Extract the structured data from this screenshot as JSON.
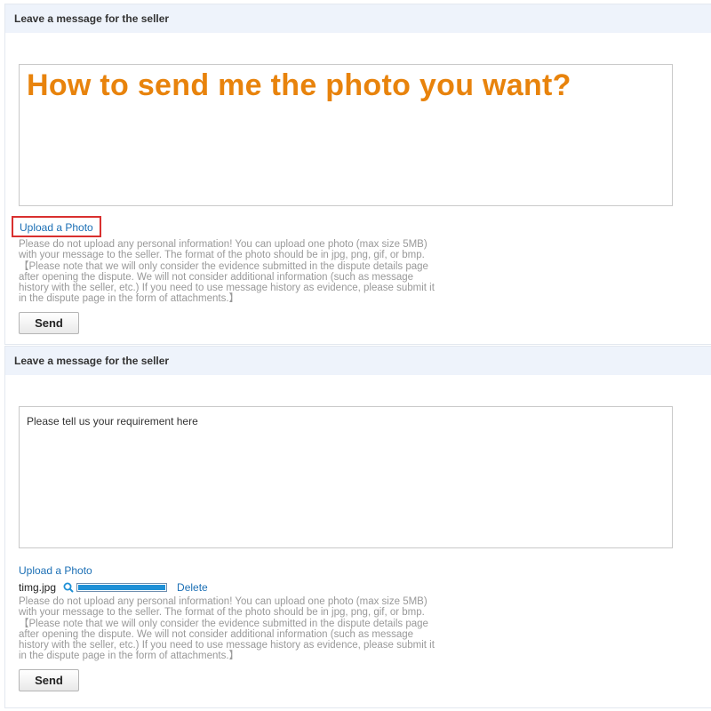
{
  "sections": [
    {
      "header": "Leave a message for the seller",
      "message_text": "How to send me the photo you want?",
      "upload_label": "Upload a Photo",
      "notice_lines": [
        "Please do not upload any personal information! You can upload one photo (max size 5MB)",
        "with your message to the seller. The format of the photo should be in jpg, png, gif, or bmp.",
        "【Please note that we will only consider the evidence submitted in the dispute details page",
        "after opening the dispute. We will not consider additional information (such as message",
        "history with the seller, etc.) If you need to use message history as evidence, please submit it",
        "in the dispute page in the form of attachments.】"
      ],
      "send_label": "Send"
    },
    {
      "header": "Leave a message for the seller",
      "message_text": "Please tell us your requirement here",
      "upload_label": "Upload a Photo",
      "file": {
        "name": "timg.jpg",
        "progress": 1.0,
        "delete_label": "Delete"
      },
      "notice_lines": [
        "Please do not upload any personal information! You can upload one photo (max size 5MB)",
        "with your message to the seller. The format of the photo should be in jpg, png, gif, or bmp.",
        "【Please note that we will only consider the evidence submitted in the dispute details page",
        "after opening the dispute. We will not consider additional information (such as message",
        "history with the seller, etc.) If you need to use message history as evidence, please submit it",
        "in the dispute page in the form of attachments.】"
      ],
      "send_label": "Send"
    }
  ],
  "colors": {
    "header_bg": "#eef3fb",
    "link": "#1b6fb5",
    "highlight_text": "#e8830c",
    "highlight_border": "#d9302f",
    "notice_text": "#999999",
    "progress_fill": "#1e90d6"
  },
  "icons": {
    "preview": "search-icon"
  }
}
